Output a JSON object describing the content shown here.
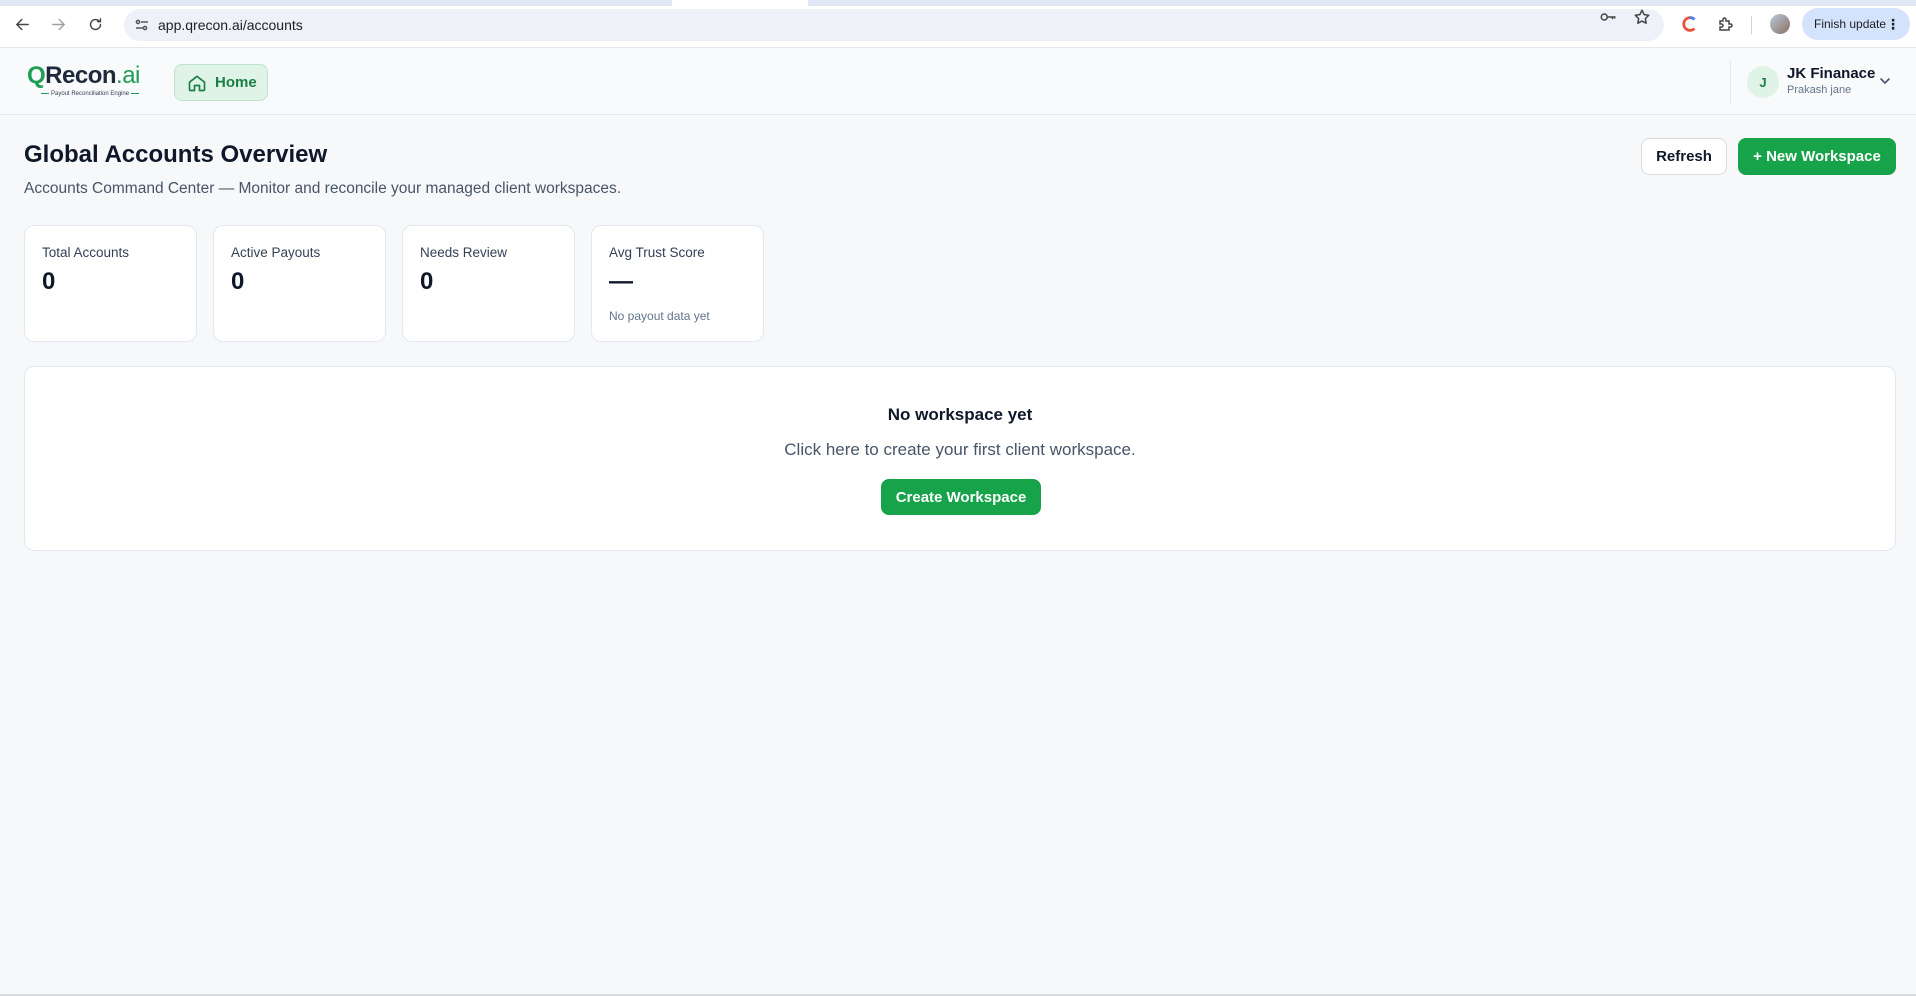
{
  "browser": {
    "url": "app.qrecon.ai/accounts",
    "finish_update_label": "Finish update"
  },
  "header": {
    "logo": {
      "q": "Q",
      "recon": "Recon",
      "ai": ".ai",
      "tagline": "Payout Reconciliation Engine"
    },
    "home_label": "Home",
    "user": {
      "initial": "J",
      "org_name": "JK Finanace",
      "person_name": "Prakash jane"
    }
  },
  "main": {
    "title": "Global Accounts Overview",
    "subtitle": "Accounts Command Center — Monitor and reconcile your managed client workspaces.",
    "refresh_label": "Refresh",
    "new_workspace_label": "+ New Workspace",
    "stats": [
      {
        "label": "Total Accounts",
        "value": "0",
        "note": ""
      },
      {
        "label": "Active Payouts",
        "value": "0",
        "note": ""
      },
      {
        "label": "Needs Review",
        "value": "0",
        "note": ""
      },
      {
        "label": "Avg Trust Score",
        "value": "—",
        "note": "No payout data yet"
      }
    ],
    "empty_state": {
      "title": "No workspace yet",
      "text": "Click here to create your first client workspace.",
      "button_label": "Create Workspace"
    }
  },
  "colors": {
    "accent": "#16a34a",
    "accent_light": "#dff3e6",
    "text_dark": "#0f172a",
    "text_muted": "#475569"
  }
}
